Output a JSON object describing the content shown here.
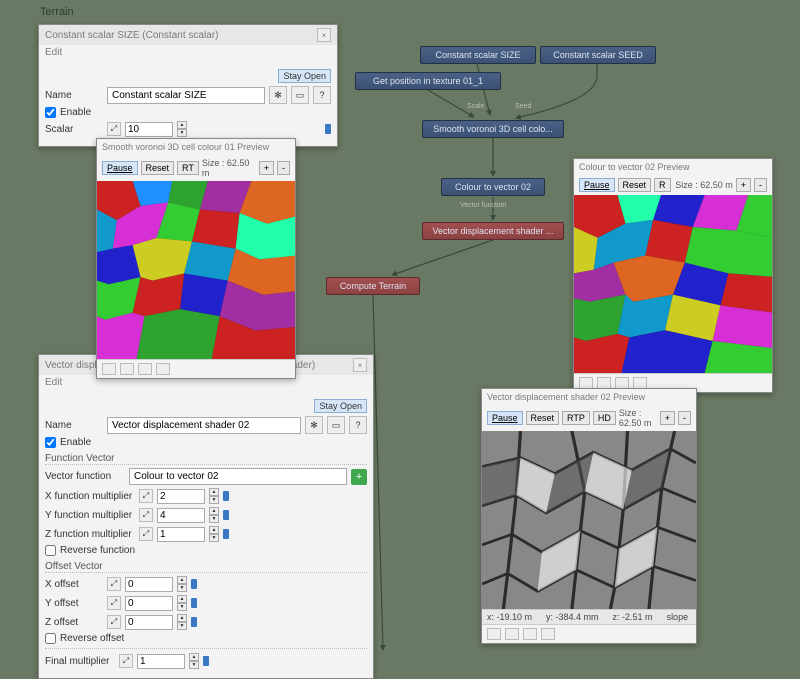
{
  "header": {
    "title": "Terrain"
  },
  "graph": {
    "nodes": {
      "size": "Constant scalar SIZE",
      "pos": "Get position in texture 01_1",
      "seed": "Constant scalar SEED",
      "voronoi": "Smooth voronoi 3D cell colo...",
      "c2v": "Colour to vector 02",
      "vds": "Vector displacement shader ...",
      "compute": "Compute Terrain"
    },
    "edge_labels": {
      "scale": "Scale",
      "seed": "Seed",
      "vecfn": "Vector function"
    }
  },
  "panel_size": {
    "title": "Constant scalar SIZE   (Constant scalar)",
    "edit": "Edit",
    "stay_open": "Stay Open",
    "name_label": "Name",
    "name_value": "Constant scalar SIZE",
    "enable_label": "Enable",
    "enable_checked": true,
    "scalar_label": "Scalar",
    "scalar_value": "10"
  },
  "panel_vds": {
    "title": "Vector displacement shader 02   (Vector displacement shader)",
    "edit": "Edit",
    "stay_open": "Stay Open",
    "name_label": "Name",
    "name_value": "Vector displacement shader 02",
    "enable_label": "Enable",
    "group_fn": "Function Vector",
    "vecfn_label": "Vector function",
    "vecfn_value": "Colour to vector 02",
    "xmul_label": "X function multiplier",
    "xmul_value": "2",
    "ymul_label": "Y function multiplier",
    "ymul_value": "4",
    "zmul_label": "Z function multiplier",
    "zmul_value": "1",
    "revfn_label": "Reverse function",
    "group_off": "Offset Vector",
    "xo_label": "X offset",
    "xo_value": "0",
    "yo_label": "Y offset",
    "yo_value": "0",
    "zo_label": "Z offset",
    "zo_value": "0",
    "revoff_label": "Reverse offset",
    "final_label": "Final multiplier",
    "final_value": "1"
  },
  "previews": {
    "voronoi_title": "Smooth voronoi 3D cell colour 01 Preview",
    "c2v_title": "Colour to vector 02 Preview",
    "vds_title": "Vector displacement shader 02 Preview",
    "pause": "Pause",
    "reset": "Reset",
    "rt": "RT",
    "r": "R",
    "rtp": "RTP",
    "hd": "HD",
    "size1": "Size : 62.50 m",
    "size2": "Size : 62.50 m",
    "size3": "Size : 62.50 m",
    "plus": "+",
    "minus": "-",
    "coords": {
      "x": "x: -19.10 m",
      "y": "y: -384.4 mm",
      "z": "z: -2.51 m",
      "slope": "slope"
    }
  }
}
